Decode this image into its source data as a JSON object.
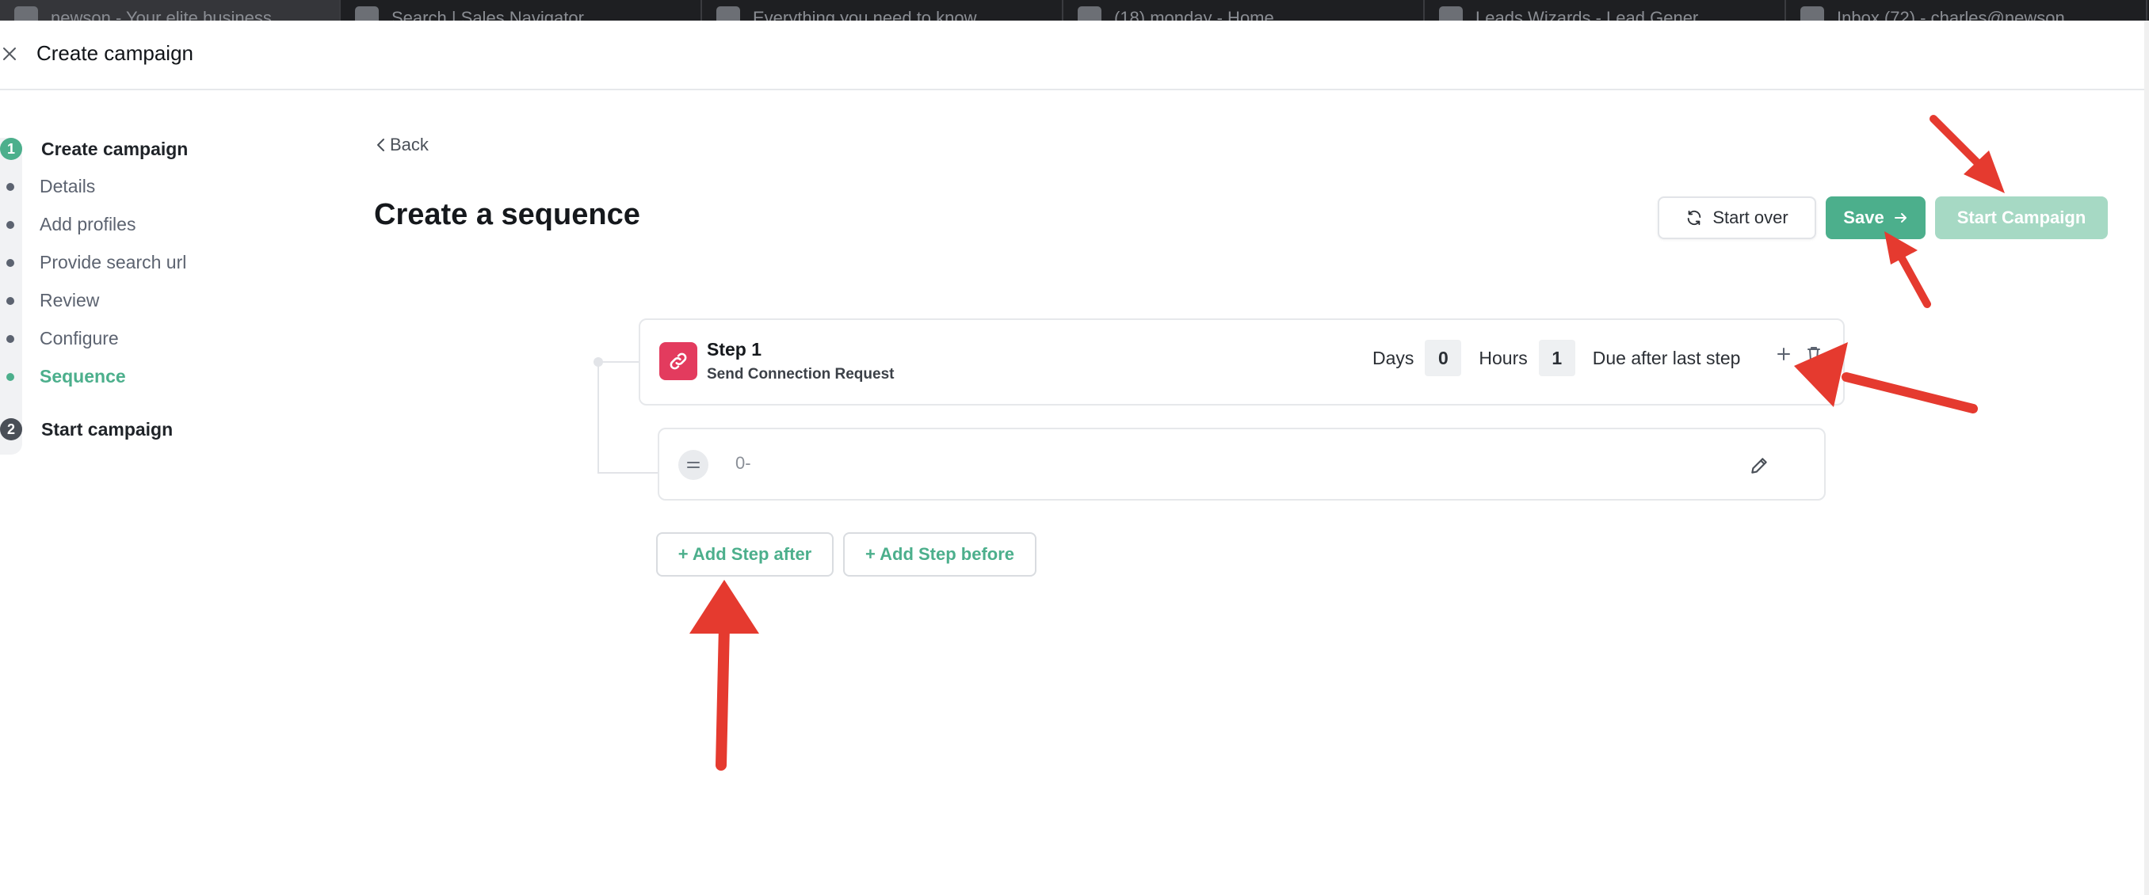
{
  "browser_tabs": [
    {
      "title": "newson - Your elite business..."
    },
    {
      "title": "Search | Sales Navigator"
    },
    {
      "title": "Everything you need to know..."
    },
    {
      "title": "(18) monday - Home"
    },
    {
      "title": "Leads Wizards - Lead Gener..."
    },
    {
      "title": "Inbox (72) - charles@newson..."
    }
  ],
  "header": {
    "title": "Create campaign",
    "close_icon": "close-icon"
  },
  "stepper": {
    "stages": [
      {
        "number": "1",
        "label": "Create campaign",
        "color": "#4caf8c"
      },
      {
        "number": "2",
        "label": "Start campaign",
        "color": "#4a4f57"
      }
    ],
    "substeps": [
      {
        "label": "Details",
        "active": false
      },
      {
        "label": "Add profiles",
        "active": false
      },
      {
        "label": "Provide search url",
        "active": false
      },
      {
        "label": "Review",
        "active": false
      },
      {
        "label": "Configure",
        "active": false
      },
      {
        "label": "Sequence",
        "active": true
      }
    ]
  },
  "main": {
    "back_label": "Back",
    "title": "Create a sequence",
    "start_over_label": "Start over",
    "save_label": "Save",
    "start_campaign_label": "Start Campaign"
  },
  "sequence": {
    "step": {
      "name": "Step 1",
      "action": "Send Connection Request",
      "days_label": "Days",
      "days_value": "0",
      "hours_label": "Hours",
      "hours_value": "1",
      "due_label": "Due after last step"
    },
    "message": {
      "text": "0-"
    },
    "add_after_label": "+ Add Step after",
    "add_before_label": "+ Add Step before"
  },
  "colors": {
    "accent": "#4caf8c",
    "accent_disabled": "#a6d9c4",
    "step_icon_bg": "#e33b5e",
    "annotation": "#e53a2f"
  }
}
